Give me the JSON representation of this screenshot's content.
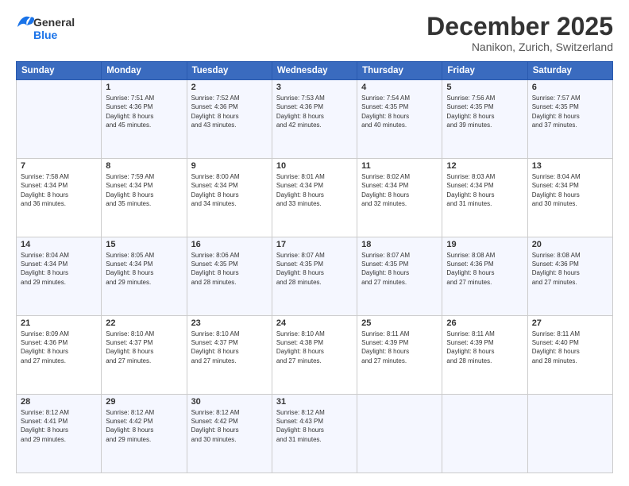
{
  "header": {
    "logo_line1": "General",
    "logo_line2": "Blue",
    "month_title": "December 2025",
    "location": "Nanikon, Zurich, Switzerland"
  },
  "calendar": {
    "days_of_week": [
      "Sunday",
      "Monday",
      "Tuesday",
      "Wednesday",
      "Thursday",
      "Friday",
      "Saturday"
    ],
    "weeks": [
      [
        {
          "day": "",
          "info": ""
        },
        {
          "day": "1",
          "info": "Sunrise: 7:51 AM\nSunset: 4:36 PM\nDaylight: 8 hours\nand 45 minutes."
        },
        {
          "day": "2",
          "info": "Sunrise: 7:52 AM\nSunset: 4:36 PM\nDaylight: 8 hours\nand 43 minutes."
        },
        {
          "day": "3",
          "info": "Sunrise: 7:53 AM\nSunset: 4:36 PM\nDaylight: 8 hours\nand 42 minutes."
        },
        {
          "day": "4",
          "info": "Sunrise: 7:54 AM\nSunset: 4:35 PM\nDaylight: 8 hours\nand 40 minutes."
        },
        {
          "day": "5",
          "info": "Sunrise: 7:56 AM\nSunset: 4:35 PM\nDaylight: 8 hours\nand 39 minutes."
        },
        {
          "day": "6",
          "info": "Sunrise: 7:57 AM\nSunset: 4:35 PM\nDaylight: 8 hours\nand 37 minutes."
        }
      ],
      [
        {
          "day": "7",
          "info": "Sunrise: 7:58 AM\nSunset: 4:34 PM\nDaylight: 8 hours\nand 36 minutes."
        },
        {
          "day": "8",
          "info": "Sunrise: 7:59 AM\nSunset: 4:34 PM\nDaylight: 8 hours\nand 35 minutes."
        },
        {
          "day": "9",
          "info": "Sunrise: 8:00 AM\nSunset: 4:34 PM\nDaylight: 8 hours\nand 34 minutes."
        },
        {
          "day": "10",
          "info": "Sunrise: 8:01 AM\nSunset: 4:34 PM\nDaylight: 8 hours\nand 33 minutes."
        },
        {
          "day": "11",
          "info": "Sunrise: 8:02 AM\nSunset: 4:34 PM\nDaylight: 8 hours\nand 32 minutes."
        },
        {
          "day": "12",
          "info": "Sunrise: 8:03 AM\nSunset: 4:34 PM\nDaylight: 8 hours\nand 31 minutes."
        },
        {
          "day": "13",
          "info": "Sunrise: 8:04 AM\nSunset: 4:34 PM\nDaylight: 8 hours\nand 30 minutes."
        }
      ],
      [
        {
          "day": "14",
          "info": "Sunrise: 8:04 AM\nSunset: 4:34 PM\nDaylight: 8 hours\nand 29 minutes."
        },
        {
          "day": "15",
          "info": "Sunrise: 8:05 AM\nSunset: 4:34 PM\nDaylight: 8 hours\nand 29 minutes."
        },
        {
          "day": "16",
          "info": "Sunrise: 8:06 AM\nSunset: 4:35 PM\nDaylight: 8 hours\nand 28 minutes."
        },
        {
          "day": "17",
          "info": "Sunrise: 8:07 AM\nSunset: 4:35 PM\nDaylight: 8 hours\nand 28 minutes."
        },
        {
          "day": "18",
          "info": "Sunrise: 8:07 AM\nSunset: 4:35 PM\nDaylight: 8 hours\nand 27 minutes."
        },
        {
          "day": "19",
          "info": "Sunrise: 8:08 AM\nSunset: 4:36 PM\nDaylight: 8 hours\nand 27 minutes."
        },
        {
          "day": "20",
          "info": "Sunrise: 8:08 AM\nSunset: 4:36 PM\nDaylight: 8 hours\nand 27 minutes."
        }
      ],
      [
        {
          "day": "21",
          "info": "Sunrise: 8:09 AM\nSunset: 4:36 PM\nDaylight: 8 hours\nand 27 minutes."
        },
        {
          "day": "22",
          "info": "Sunrise: 8:10 AM\nSunset: 4:37 PM\nDaylight: 8 hours\nand 27 minutes."
        },
        {
          "day": "23",
          "info": "Sunrise: 8:10 AM\nSunset: 4:37 PM\nDaylight: 8 hours\nand 27 minutes."
        },
        {
          "day": "24",
          "info": "Sunrise: 8:10 AM\nSunset: 4:38 PM\nDaylight: 8 hours\nand 27 minutes."
        },
        {
          "day": "25",
          "info": "Sunrise: 8:11 AM\nSunset: 4:39 PM\nDaylight: 8 hours\nand 27 minutes."
        },
        {
          "day": "26",
          "info": "Sunrise: 8:11 AM\nSunset: 4:39 PM\nDaylight: 8 hours\nand 28 minutes."
        },
        {
          "day": "27",
          "info": "Sunrise: 8:11 AM\nSunset: 4:40 PM\nDaylight: 8 hours\nand 28 minutes."
        }
      ],
      [
        {
          "day": "28",
          "info": "Sunrise: 8:12 AM\nSunset: 4:41 PM\nDaylight: 8 hours\nand 29 minutes."
        },
        {
          "day": "29",
          "info": "Sunrise: 8:12 AM\nSunset: 4:42 PM\nDaylight: 8 hours\nand 29 minutes."
        },
        {
          "day": "30",
          "info": "Sunrise: 8:12 AM\nSunset: 4:42 PM\nDaylight: 8 hours\nand 30 minutes."
        },
        {
          "day": "31",
          "info": "Sunrise: 8:12 AM\nSunset: 4:43 PM\nDaylight: 8 hours\nand 31 minutes."
        },
        {
          "day": "",
          "info": ""
        },
        {
          "day": "",
          "info": ""
        },
        {
          "day": "",
          "info": ""
        }
      ]
    ]
  }
}
